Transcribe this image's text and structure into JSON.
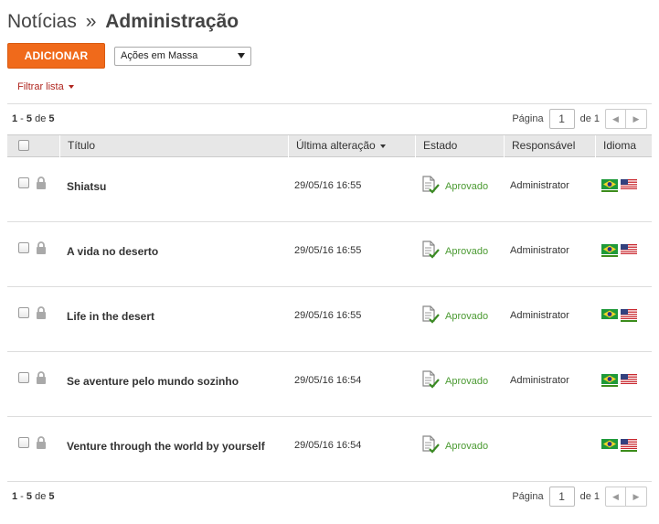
{
  "header": {
    "crumb": "Notícias",
    "separator": "»",
    "current": "Administração"
  },
  "toolbar": {
    "add_label": "ADICIONAR",
    "mass_actions_selected": "Ações em Massa"
  },
  "filter": {
    "label": "Filtrar lista"
  },
  "summary": {
    "range_start": "1",
    "range_sep": " - ",
    "range_end": "5",
    "of_label": " de ",
    "total": "5"
  },
  "pager": {
    "page_label": "Página",
    "page_value": "1",
    "of_label": "de 1",
    "prev_glyph": "◀",
    "next_glyph": "▶"
  },
  "table": {
    "columns": {
      "title": "Título",
      "last_modified": "Última alteração",
      "state": "Estado",
      "owner": "Responsável",
      "language": "Idioma"
    },
    "rows": [
      {
        "title": "Shiatsu",
        "date": "29/05/16 16:55",
        "state": "Aprovado",
        "owner": "Administrator",
        "active_lang": "pt"
      },
      {
        "title": "A vida no deserto",
        "date": "29/05/16 16:55",
        "state": "Aprovado",
        "owner": "Administrator",
        "active_lang": "pt"
      },
      {
        "title": "Life in the desert",
        "date": "29/05/16 16:55",
        "state": "Aprovado",
        "owner": "Administrator",
        "active_lang": "en"
      },
      {
        "title": "Se aventure pelo mundo sozinho",
        "date": "29/05/16 16:54",
        "state": "Aprovado",
        "owner": "Administrator",
        "active_lang": "pt"
      },
      {
        "title": "Venture through the world by yourself",
        "date": "29/05/16 16:54",
        "state": "Aprovado",
        "owner": "",
        "active_lang": "en"
      }
    ]
  },
  "colors": {
    "accent": "#f06a1b",
    "filter_link": "#b0261f",
    "approved": "#4a9a31"
  },
  "icons": {
    "lock": "lock-icon",
    "approved": "approved-document-icon",
    "flag_pt": "brazil-flag-icon",
    "flag_en": "usa-flag-icon"
  }
}
